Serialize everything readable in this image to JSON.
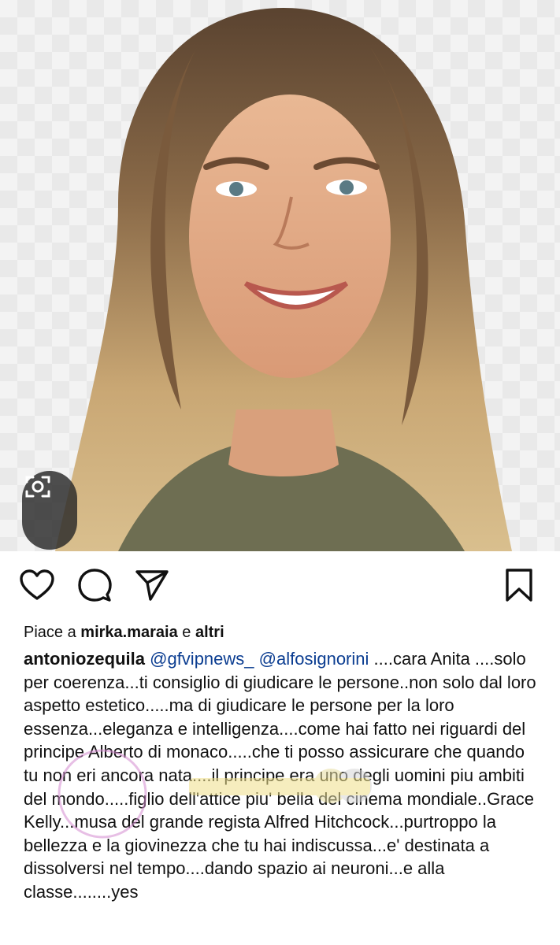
{
  "post": {
    "image_alt": "Smiling woman with long wavy blonde hair wearing an olive top",
    "likes": {
      "prefix": "Piace a",
      "user": "mirka.maraia",
      "connector": "e",
      "others": "altri"
    },
    "caption": {
      "username": "antoniozequila",
      "mention1": "@gfvipnews_",
      "mention2": "@alfosignorini",
      "text": "....cara Anita ....solo per coerenza...ti consiglio di giudicare le persone..non solo dal loro aspetto estetico.....ma di giudicare le persone per la  loro essenza...eleganza e intelligenza....come hai fatto nei riguardi del principe Alberto di monaco.....che ti posso assicurare che quando tu non eri ancora nata....il principe era uno degli uomini piu ambiti del mondo.....figlio dell'attice piu' bella del cinema mondiale..Grace Kelly...musa del grande regista Alfred Hitchcock...purtroppo la bellezza e la giovinezza che tu hai  indiscussa...e' destinata a dissolversi nel tempo....dando spazio ai neuroni...e alla classe........yes"
    }
  },
  "icons": {
    "like": "heart-icon",
    "comment": "comment-icon",
    "share": "send-icon",
    "save": "bookmark-icon",
    "lens": "visual-search-icon"
  },
  "colors": {
    "text": "#111111",
    "mention": "#0b3d91",
    "background": "#ffffff"
  }
}
